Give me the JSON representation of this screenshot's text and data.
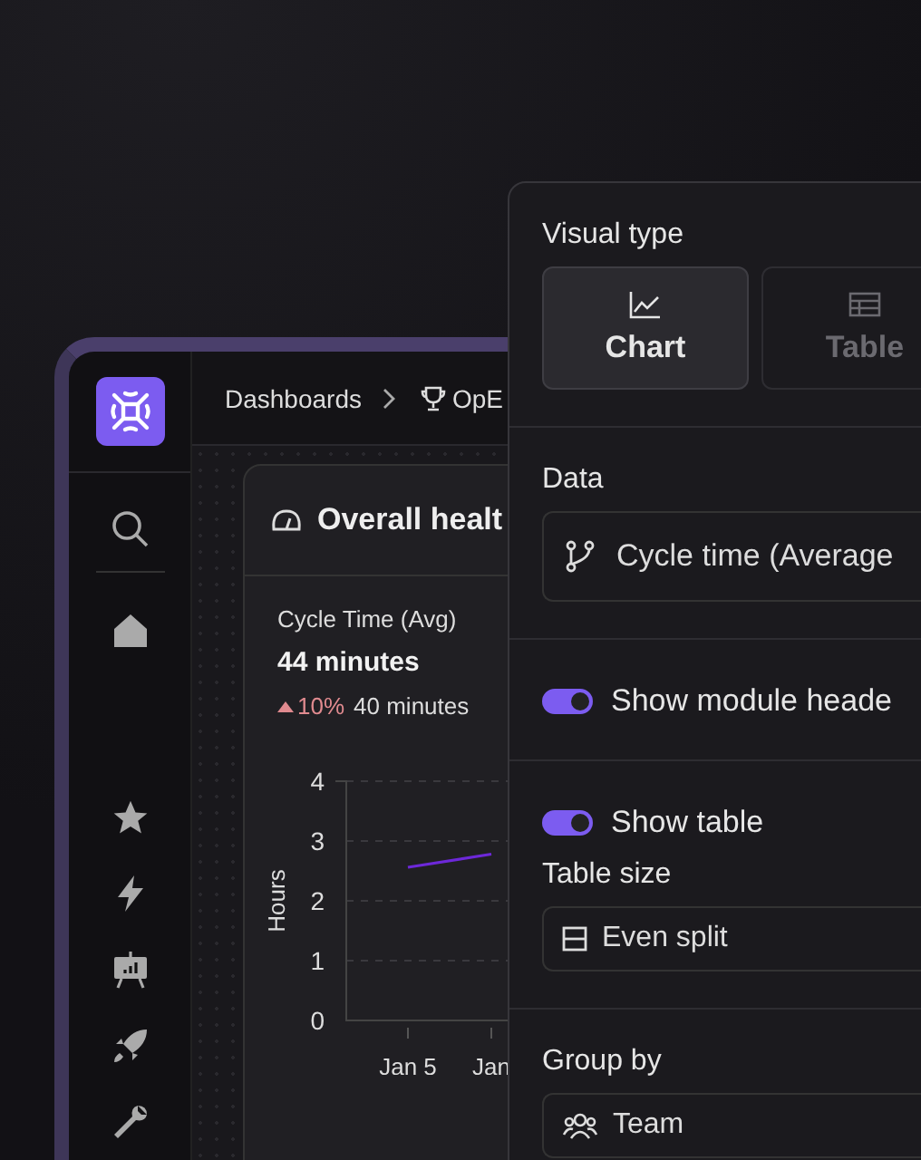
{
  "app": {
    "breadcrumb": [
      "Dashboards",
      "OpE"
    ]
  },
  "card": {
    "title": "Overall healt",
    "metric": {
      "label": "Cycle Time (Avg)",
      "value": "44 minutes",
      "change": "10%",
      "previous": "40 minutes"
    },
    "chart_data": {
      "type": "line",
      "ylabel": "Hours",
      "x": [
        "Jan 5",
        "Jan"
      ],
      "yticks": [
        0,
        1,
        2,
        3,
        4
      ],
      "ylim": [
        0,
        4
      ],
      "grid": true,
      "series": [
        {
          "color": "#6d28d9",
          "values": [
            2.56,
            2.78
          ]
        }
      ]
    }
  },
  "panel": {
    "visual_type": {
      "label": "Visual type",
      "options": [
        {
          "label": "Chart",
          "kind": "chart",
          "selected": true
        },
        {
          "label": "Table",
          "kind": "table",
          "selected": false
        }
      ]
    },
    "data": {
      "label": "Data",
      "value": "Cycle time (Average"
    },
    "toggles": [
      {
        "label": "Show module heade",
        "on": true
      },
      {
        "label": "Show table",
        "on": true
      }
    ],
    "table_size": {
      "label": "Table size",
      "value": "Even split"
    },
    "group_by": {
      "label": "Group by",
      "value": "Team"
    }
  }
}
